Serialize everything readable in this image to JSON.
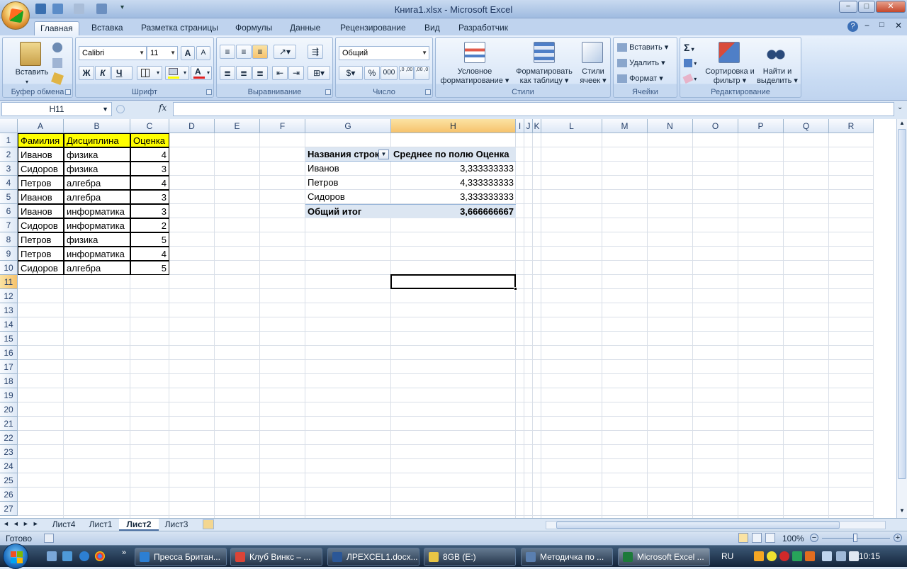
{
  "window": {
    "title": "Книга1.xlsx - Microsoft Excel",
    "controls": [
      "−",
      "□",
      "✕"
    ],
    "ribbon_controls": [
      "?",
      "−",
      "□",
      "✕"
    ]
  },
  "tabs": [
    "Главная",
    "Вставка",
    "Разметка страницы",
    "Формулы",
    "Данные",
    "Рецензирование",
    "Вид",
    "Разработчик"
  ],
  "ribbon": {
    "clipboard": {
      "paste": "Вставить",
      "label": "Буфер обмена"
    },
    "font": {
      "name": "Calibri",
      "size": "11",
      "label": "Шрифт",
      "bold": "Ж",
      "italic": "К",
      "underline": "Ч",
      "grow": "A",
      "shrink": "A",
      "color_letter": "A"
    },
    "alignment": {
      "label": "Выравнивание"
    },
    "number": {
      "format": "Общий",
      "label": "Число",
      "percent": "%",
      "thousands": "000",
      "inc_dec": ",0 ,00",
      "dec_dec": ",00 ,0"
    },
    "styles": {
      "conditional": "Условное форматирование",
      "as_table": "Форматировать как таблицу",
      "cell_styles": "Стили ячеек",
      "label": "Стили"
    },
    "cells": {
      "insert": "Вставить",
      "delete": "Удалить",
      "format": "Формат",
      "label": "Ячейки"
    },
    "editing": {
      "sum": "Σ",
      "sort": "Сортировка и фильтр",
      "find": "Найти и выделить",
      "label": "Редактирование"
    }
  },
  "formula_bar": {
    "name_box": "H11",
    "fx": "fx",
    "formula": ""
  },
  "columns": [
    "A",
    "B",
    "C",
    "D",
    "E",
    "F",
    "G",
    "H",
    "I",
    "J",
    "K",
    "L",
    "M",
    "N",
    "O",
    "P",
    "Q",
    "R"
  ],
  "rows": [
    "1",
    "2",
    "3",
    "4",
    "5",
    "6",
    "7",
    "8",
    "9",
    "10",
    "11",
    "12",
    "13",
    "14",
    "15",
    "16",
    "17",
    "18",
    "19",
    "20",
    "21",
    "22",
    "23",
    "24",
    "25",
    "26",
    "27"
  ],
  "selected_cell": "H11",
  "table": {
    "headers": [
      "Фамилия",
      "Дисциплина",
      "Оценка"
    ],
    "rows": [
      [
        "Иванов",
        "физика",
        "4"
      ],
      [
        "Сидоров",
        "физика",
        "3"
      ],
      [
        "Петров",
        "алгебра",
        "4"
      ],
      [
        "Иванов",
        "алгебра",
        "3"
      ],
      [
        "Иванов",
        "информатика",
        "3"
      ],
      [
        "Сидоров",
        "информатика",
        "2"
      ],
      [
        "Петров",
        "физика",
        "5"
      ],
      [
        "Петров",
        "информатика",
        "4"
      ],
      [
        "Сидоров",
        "алгебра",
        "5"
      ]
    ]
  },
  "pivot": {
    "row_header": "Названия строк",
    "value_header": "Среднее по полю Оценка",
    "rows": [
      [
        "Иванов",
        "3,333333333"
      ],
      [
        "Петров",
        "4,333333333"
      ],
      [
        "Сидоров",
        "3,333333333"
      ]
    ],
    "total": [
      "Общий итог",
      "3,666666667"
    ]
  },
  "sheets": [
    "Лист4",
    "Лист1",
    "Лист2",
    "Лист3"
  ],
  "active_sheet": "Лист2",
  "status": {
    "ready": "Готово",
    "zoom": "100%"
  },
  "taskbar": {
    "items": [
      "Пресса Британ...",
      "Клуб Винкс – ...",
      "ЛРEXCEL1.docx...",
      "8GB (E:)",
      "Методичка по ...",
      "Microsoft Excel ..."
    ],
    "lang": "RU",
    "time": "10:15"
  },
  "colors": {
    "accent": "#f6c26c",
    "yellow": "#ffff00",
    "pivot_band": "#dce6f2"
  }
}
